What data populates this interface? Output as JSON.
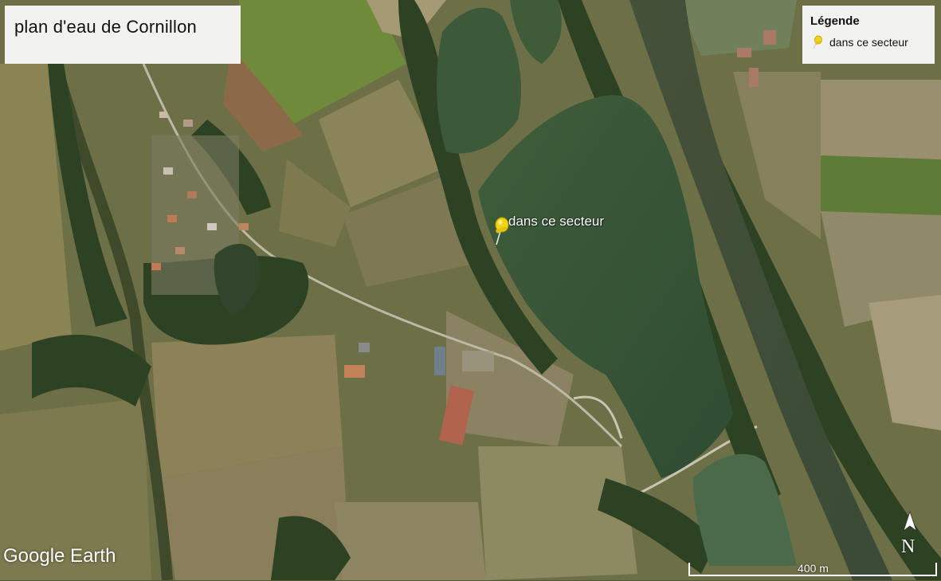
{
  "map": {
    "title": "plan d'eau de Cornillon",
    "pin_label": "dans ce secteur",
    "brand": "Google Earth",
    "north_label": "N",
    "scale_label": "400 m",
    "pin_color": "#f2d316"
  },
  "legend": {
    "title": "Légende",
    "items": [
      {
        "icon": "yellow-pushpin-icon",
        "label": "dans ce secteur"
      }
    ]
  }
}
